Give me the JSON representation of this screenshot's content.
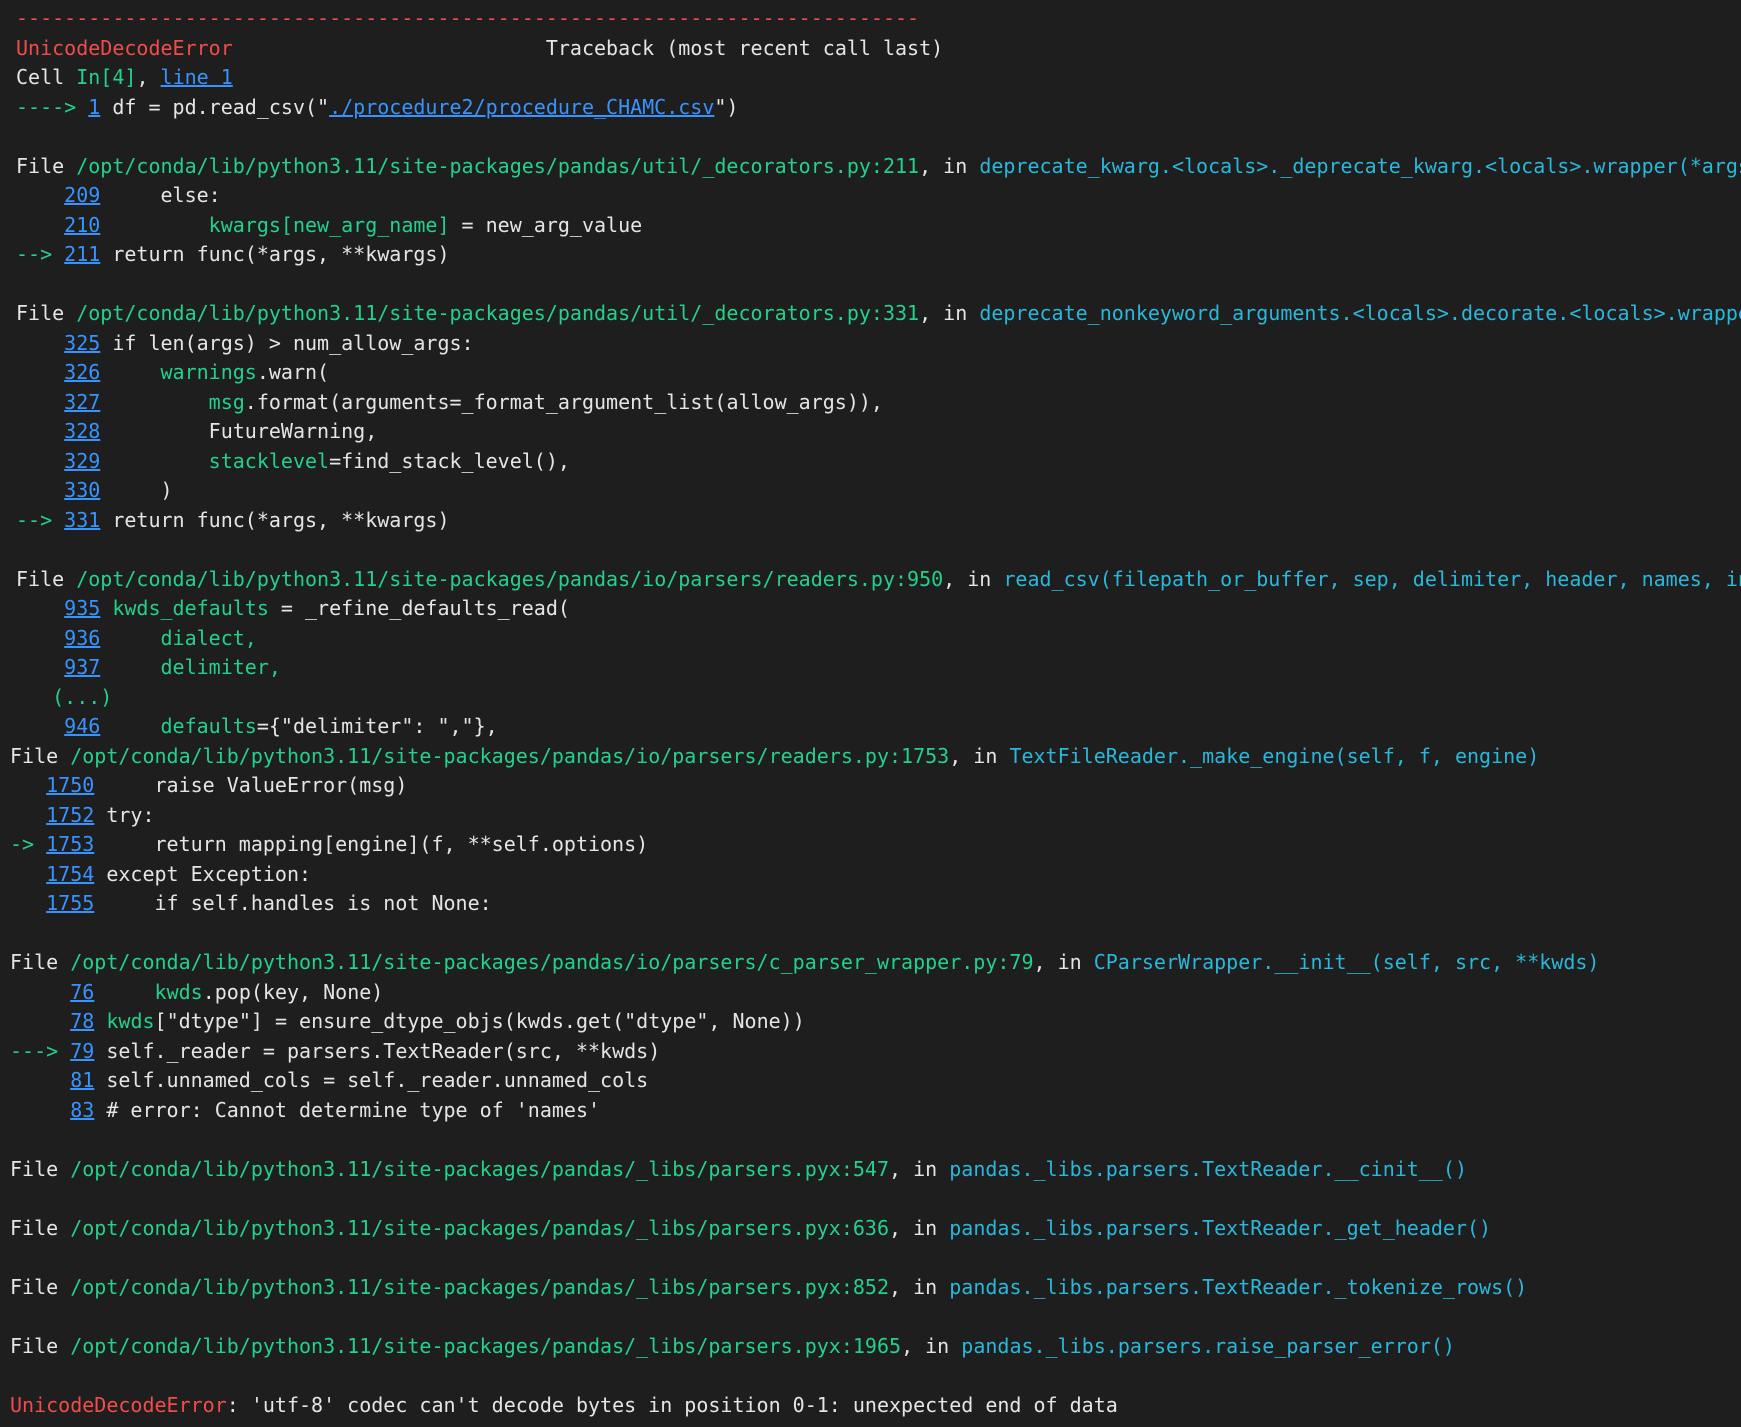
{
  "traceback": {
    "separator": "---------------------------------------------------------------------------",
    "error_type": "UnicodeDecodeError",
    "header_gap": "                          ",
    "header_title": "Traceback (most recent call last)",
    "cell": {
      "prefix": "Cell ",
      "ref": "In[4]",
      "sep": ", ",
      "line_link": "line 1"
    },
    "entry": {
      "arrow": "----> ",
      "num": "1",
      "code_before": " df = pd.read_csv(\"",
      "path_link": "./procedure2/procedure_CHAMC.csv",
      "code_after": "\")"
    },
    "frames": {
      "f1": {
        "file_word": "File ",
        "path": "/opt/conda/lib/python3.11/site-packages/pandas/util/_decorators.py:211",
        "in_word": ", in ",
        "func": "deprecate_kwarg.<locals>._deprecate_kwarg.<locals>.wrapper(*args, **kwargs)",
        "l209": {
          "num": "209",
          "code": "     else:"
        },
        "l210": {
          "num": "210",
          "pre": "         ",
          "var": "kwargs[new_arg_name]",
          "rest": " = new_arg_value"
        },
        "l211": {
          "arrow": "--> ",
          "num": "211",
          "code": " return func(*args, **kwargs)"
        }
      },
      "f2": {
        "file_word": "File ",
        "path": "/opt/conda/lib/python3.11/site-packages/pandas/util/_decorators.py:331",
        "in_word": ", in ",
        "func": "deprecate_nonkeyword_arguments.<locals>.decorate.<locals>.wrapper(*args, **kwargs)",
        "l325": {
          "num": "325",
          "code": " if len(args) > num_allow_args:"
        },
        "l326": {
          "num": "326",
          "pre": "     ",
          "var": "warnings",
          "rest": ".warn("
        },
        "l327": {
          "num": "327",
          "pre": "         ",
          "var": "msg",
          "rest": ".format(arguments=_format_argument_list(allow_args)),"
        },
        "l328": {
          "num": "328",
          "code": "         FutureWarning,"
        },
        "l329": {
          "num": "329",
          "pre": "         ",
          "var": "stacklevel",
          "rest": "=find_stack_level(),"
        },
        "l330": {
          "num": "330",
          "code": "     )"
        },
        "l331": {
          "arrow": "--> ",
          "num": "331",
          "code": " return func(*args, **kwargs)"
        }
      },
      "f3": {
        "file_word": "File ",
        "path": "/opt/conda/lib/python3.11/site-packages/pandas/io/parsers/readers.py:950",
        "in_word": ", in ",
        "func": "read_csv(filepath_or_buffer, sep, delimiter, header, names, index_col, usecols, dtype, engine, converters)",
        "l935": {
          "num": "935",
          "pre": " ",
          "var": "kwds_defaults",
          "rest": " = _refine_defaults_read("
        },
        "l936": {
          "num": "936",
          "code": "     dialect,"
        },
        "l937": {
          "num": "937",
          "code": "     delimiter,"
        },
        "ellipsis": "(...)",
        "l946": {
          "num": "946",
          "pre": "     ",
          "var": "defaults",
          "rest": "={\"delimiter\": \",\"},"
        }
      },
      "f4": {
        "file_word": "File ",
        "path": "/opt/conda/lib/python3.11/site-packages/pandas/io/parsers/readers.py:1753",
        "in_word": ", in ",
        "func": "TextFileReader._make_engine(self, f, engine)",
        "l1750": {
          "num": "1750",
          "code": "     raise ValueError(msg)"
        },
        "l1752": {
          "num": "1752",
          "code": " try:"
        },
        "l1753": {
          "arrow": "-> ",
          "num": "1753",
          "code": "     return mapping[engine](f, **self.options)"
        },
        "l1754": {
          "num": "1754",
          "code": " except Exception:"
        },
        "l1755": {
          "num": "1755",
          "code": "     if self.handles is not None:"
        }
      },
      "f5": {
        "file_word": "File ",
        "path": "/opt/conda/lib/python3.11/site-packages/pandas/io/parsers/c_parser_wrapper.py:79",
        "in_word": ", in ",
        "func": "CParserWrapper.__init__(self, src, **kwds)",
        "l76": {
          "num": "76",
          "pre": "     ",
          "var": "kwds",
          "rest": ".pop(key, None)"
        },
        "l78": {
          "num": "78",
          "pre": " ",
          "var": "kwds",
          "rest": "[\"dtype\"] = ensure_dtype_objs(kwds.get(\"dtype\", None))"
        },
        "l79": {
          "arrow": "---> ",
          "num": "79",
          "code": " self._reader = parsers.TextReader(src, **kwds)"
        },
        "l81": {
          "num": "81",
          "code": " self.unnamed_cols = self._reader.unnamed_cols"
        },
        "l83": {
          "num": "83",
          "code": " # error: Cannot determine type of 'names'"
        }
      },
      "f6": {
        "file_word": "File ",
        "path": "/opt/conda/lib/python3.11/site-packages/pandas/_libs/parsers.pyx:547",
        "in_word": ", in ",
        "func": "pandas._libs.parsers.TextReader.__cinit__()"
      },
      "f7": {
        "file_word": "File ",
        "path": "/opt/conda/lib/python3.11/site-packages/pandas/_libs/parsers.pyx:636",
        "in_word": ", in ",
        "func": "pandas._libs.parsers.TextReader._get_header()"
      },
      "f8": {
        "file_word": "File ",
        "path": "/opt/conda/lib/python3.11/site-packages/pandas/_libs/parsers.pyx:852",
        "in_word": ", in ",
        "func": "pandas._libs.parsers.TextReader._tokenize_rows()"
      },
      "f9": {
        "file_word": "File ",
        "path": "/opt/conda/lib/python3.11/site-packages/pandas/_libs/parsers.pyx:1965",
        "in_word": ", in ",
        "func": "pandas._libs.parsers.raise_parser_error()"
      }
    },
    "final": {
      "type": "UnicodeDecodeError",
      "message": ": 'utf-8' codec can't decode bytes in position 0-1: unexpected end of data"
    }
  }
}
